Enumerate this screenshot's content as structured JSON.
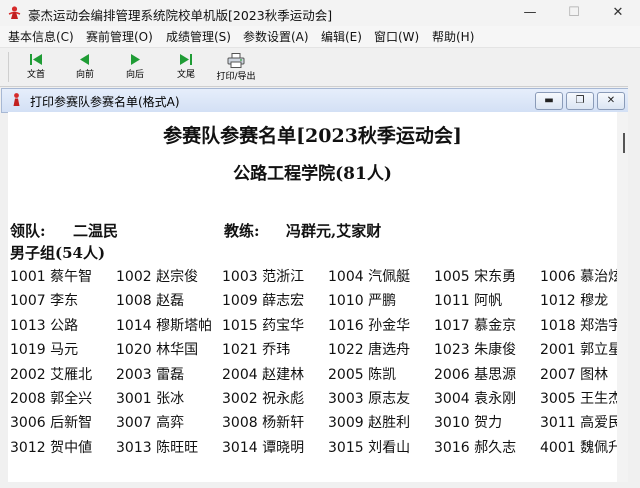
{
  "window": {
    "title": "豪杰运动会编排管理系统院校单机版[2023秋季运动会]",
    "controls": {
      "minimize": "—",
      "maximize": "☐",
      "close": "✕"
    }
  },
  "menu": [
    "基本信息(C)",
    "赛前管理(O)",
    "成绩管理(S)",
    "参数设置(A)",
    "编辑(E)",
    "窗口(W)",
    "帮助(H)"
  ],
  "toolbar": {
    "buttons": [
      {
        "label": "文首",
        "icon": "first-page-icon"
      },
      {
        "label": "向前",
        "icon": "previous-page-icon"
      },
      {
        "label": "向后",
        "icon": "next-page-icon"
      },
      {
        "label": "文尾",
        "icon": "last-page-icon"
      },
      {
        "label": "打印/导出",
        "icon": "printer-icon"
      }
    ],
    "icon_color": "#1f9c35"
  },
  "child_window": {
    "title": "打印参赛队参赛名单(格式A)",
    "controls": {
      "minimize": "▬",
      "restore": "❐",
      "close": "✕"
    }
  },
  "document": {
    "title": "参赛队参赛名单[2023秋季运动会]",
    "subtitle": "公路工程学院(81人)",
    "leader_label": "领队:",
    "leader_value": "二温民",
    "coach_label": "教练:",
    "coach_value": "冯群元,艾家财",
    "group_title": "男子组(54人)",
    "members": [
      [
        "1001 蔡午智",
        "1002 赵宗俊",
        "1003 范浙江",
        "1004 汽佩艇",
        "1005 宋东勇",
        "1006 慕治炫"
      ],
      [
        "1007 李东",
        "1008 赵磊",
        "1009 薛志宏",
        "1010 严鹏",
        "1011 阿帆",
        "1012 穆龙"
      ],
      [
        "1013 公路",
        "1014 穆斯塔帕",
        "1015 药宝华",
        "1016 孙金华",
        "1017 慕金京",
        "1018 郑浩宇"
      ],
      [
        "1019 马元",
        "1020 林华国",
        "1021 乔玮",
        "1022 唐选舟",
        "1023 朱康俊",
        "2001 郭立星"
      ],
      [
        "2002 艾雁北",
        "2003 雷磊",
        "2004 赵建林",
        "2005 陈凯",
        "2006 基思源",
        "2007 图林"
      ],
      [
        "2008 郭全兴",
        "3001 张冰",
        "3002 祝永彪",
        "3003 原志友",
        "3004 袁永刚",
        "3005 王生杰"
      ],
      [
        "3006 后新智",
        "3007 高弈",
        "3008 杨新轩",
        "3009 赵胜利",
        "3010 贺力",
        "3011 高爱民"
      ],
      [
        "3012 贺中値",
        "3013 陈旺旺",
        "3014 谭晓明",
        "3015 刘看山",
        "3016 郝久志",
        "4001 魏佩升"
      ]
    ]
  }
}
